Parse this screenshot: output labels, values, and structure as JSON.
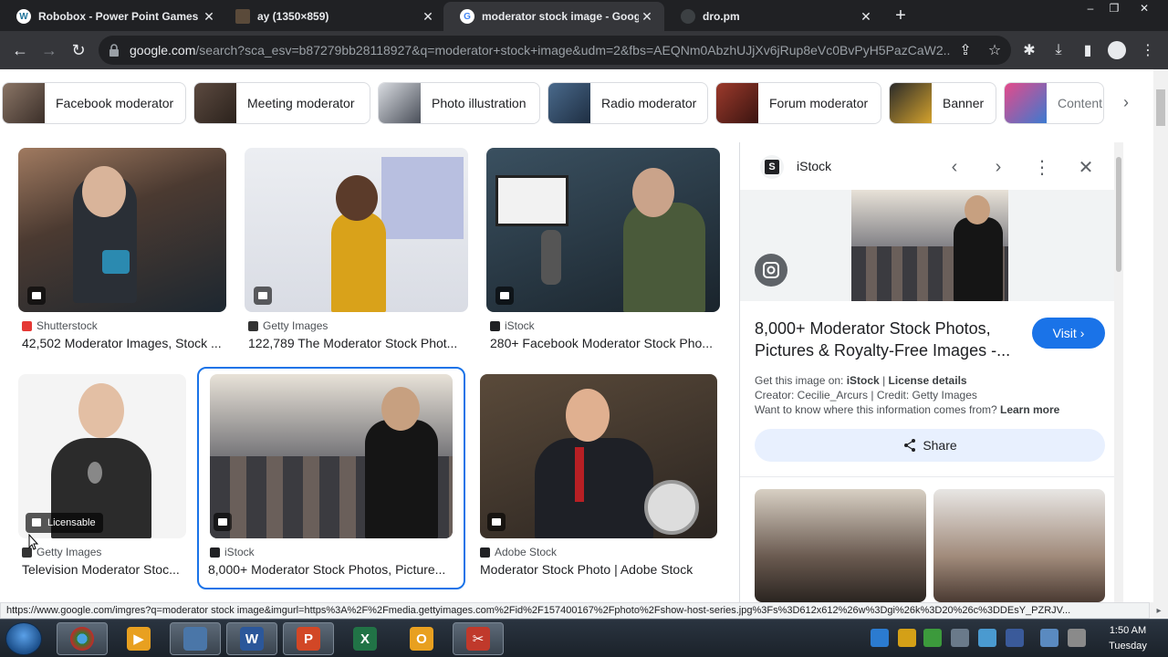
{
  "browser": {
    "tabs": [
      {
        "title": "Robobox - Power Point Games",
        "active": false
      },
      {
        "title": "ay (1350×859)",
        "active": false
      },
      {
        "title": "moderator stock image - Google",
        "active": true
      },
      {
        "title": "dro.pm",
        "active": false
      }
    ],
    "url_host": "google.com",
    "url_rest": "/search?sca_esv=b87279bb28118927&q=moderator+stock+image&udm=2&fbs=AEQNm0AbzhUJjXv6jRup8eVc0BvPyH5PazCaW2..."
  },
  "chips": [
    {
      "label": "Facebook moderator",
      "color": "#6d5a4e"
    },
    {
      "label": "Meeting moderator",
      "color": "#4a3b33"
    },
    {
      "label": "Photo illustration",
      "color": "#8a8f99"
    },
    {
      "label": "Radio moderator",
      "color": "#2f4a6a"
    },
    {
      "label": "Forum moderator",
      "color": "#7a2a22"
    },
    {
      "label": "Banner",
      "color": "#c89a2a"
    },
    {
      "label": "Content",
      "color": "#3c7ad0"
    }
  ],
  "results": [
    {
      "source": "Shutterstock",
      "title": "42,502 Moderator Images, Stock ...",
      "source_color": "#e53935"
    },
    {
      "source": "Getty Images",
      "title": "122,789 The Moderator Stock Phot...",
      "source_color": "#333333"
    },
    {
      "source": "iStock",
      "title": "280+ Facebook Moderator Stock Pho...",
      "source_color": "#202124"
    },
    {
      "source": "Getty Images",
      "title": "Television Moderator Stoc...",
      "source_color": "#333333",
      "licensable": "Licensable"
    },
    {
      "source": "iStock",
      "title": "8,000+ Moderator Stock Photos, Picture...",
      "source_color": "#202124"
    },
    {
      "source": "Adobe Stock",
      "title": "Moderator Stock Photo | Adobe Stock",
      "source_color": "#202124"
    }
  ],
  "panel": {
    "logo": "S",
    "site": "iStock",
    "title": "8,000+ Moderator Stock Photos, Pictures & Royalty-Free Images -...",
    "visit_label": "Visit",
    "get_image_prefix": "Get this image on: ",
    "get_image_site": "iStock",
    "license_details": "License details",
    "creator_line": "Creator: Cecilie_Arcurs | Credit: Getty Images",
    "want_know": "Want to know where this information comes from? ",
    "learn_more": "Learn more",
    "share_label": "Share"
  },
  "status_url": "https://www.google.com/imgres?q=moderator stock image&imgurl=https%3A%2F%2Fmedia.gettyimages.com%2Fid%2F157400167%2Fphoto%2Fshow-host-series.jpg%3Fs%3D612x612%26w%3Dgi%26k%3D20%26c%3DDEsY_PZRJV...",
  "taskbar": {
    "time": "1:50 AM",
    "day": "Tuesday"
  },
  "colors": {
    "accent": "#1a73e8",
    "tab_bg": "#202124",
    "toolbar_bg": "#35363a"
  }
}
